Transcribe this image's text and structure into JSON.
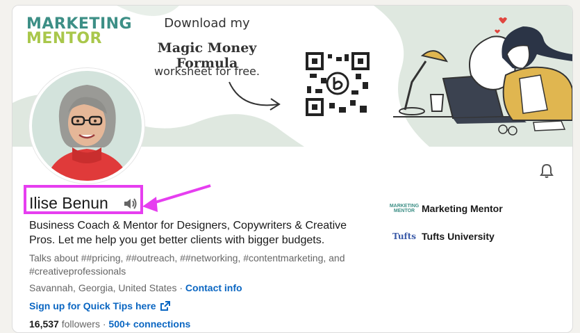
{
  "banner": {
    "logo_line1": "MARKETING",
    "logo_line2": "MENTOR",
    "promo_line1": "Download my",
    "promo_line2": "Magic Money Formula",
    "promo_line3": "worksheet for free."
  },
  "profile": {
    "name": "Ilise Benun",
    "headline": "Business Coach & Mentor for Designers, Copywriters & Creative Pros. Let me help you get better clients with bigger budgets.",
    "talks_about": "Talks about ##pricing, ##outreach, ##networking, #contentmarketing, and #creativeprofessionals",
    "location": "Savannah, Georgia, United States",
    "location_sep": " · ",
    "contact_info": "Contact info",
    "quick_tips": "Sign up for Quick Tips here",
    "followers_count": "16,537",
    "followers_label": " followers",
    "stats_sep": " · ",
    "connections": "500+ connections"
  },
  "orgs": [
    {
      "name": "Marketing Mentor",
      "logo_text": "MARKETING MENTOR"
    },
    {
      "name": "Tufts University",
      "logo_text": "Tufts"
    }
  ],
  "icons": {
    "bell": "bell-icon",
    "speaker": "speaker-icon",
    "external_link": "external-link-icon",
    "qr": "qr-code"
  },
  "colors": {
    "accent_link": "#0a66c2",
    "annotation": "#e63ef0",
    "logo_green": "#3d8f86",
    "logo_lime": "#a9c74b"
  }
}
